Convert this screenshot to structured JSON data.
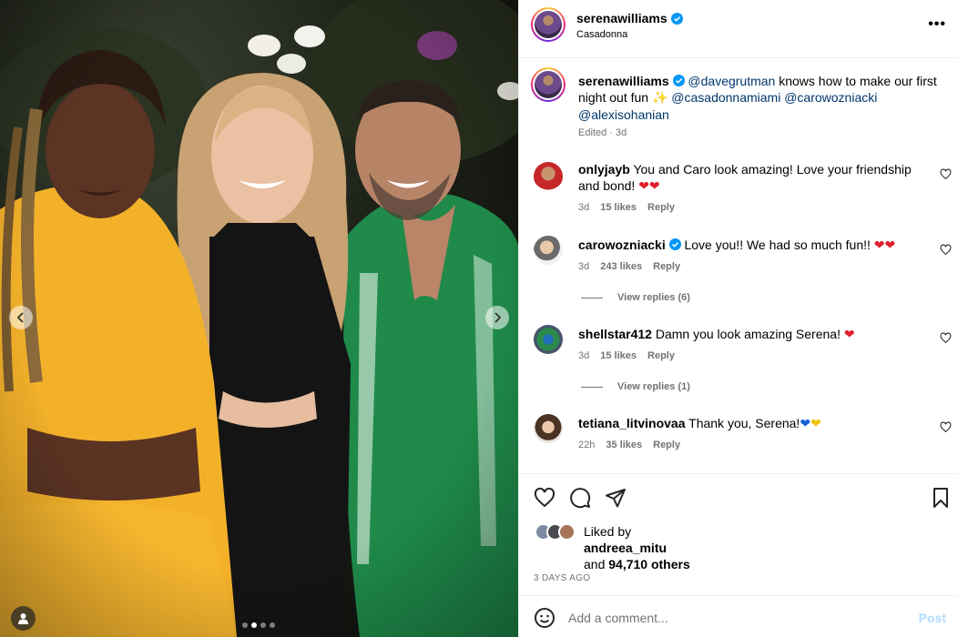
{
  "post": {
    "username": "serenawilliams",
    "location": "Casadonna",
    "more_label": "•••",
    "caption": {
      "username": "serenawilliams",
      "mention_1": "@davegrutman",
      "text_1": " knows how to make our first night out fun ",
      "sparkle_emoji": "✨",
      "mention_2": "@casadonnamiami",
      "mention_3": "@carowozniacki",
      "mention_4": "@alexisohanian",
      "meta": "Edited · 3d"
    }
  },
  "comments": [
    {
      "username": "onlyjayb",
      "text": "You and Caro look amazing! Love your friendship and bond!",
      "emoji": "❤❤",
      "time": "3d",
      "likes": "15 likes",
      "reply": "Reply"
    },
    {
      "username": "carowozniacki",
      "text": "Love you!! We had so much fun!!",
      "emoji": "❤❤",
      "time": "3d",
      "likes": "243 likes",
      "reply": "Reply",
      "view_replies": "View replies (6)"
    },
    {
      "username": "shellstar412",
      "text": "Damn you look amazing Serena!",
      "emoji": "❤",
      "time": "3d",
      "likes": "15 likes",
      "reply": "Reply",
      "view_replies": "View replies (1)"
    },
    {
      "username": "tetiana_litvinovaa",
      "text": "Thank you, Serena!",
      "emoji_blue": "❤",
      "emoji_yellow": "❤",
      "time": "22h",
      "likes": "35 likes",
      "reply": "Reply"
    }
  ],
  "likes": {
    "liked_by_label": "Liked by",
    "liked_by_user": "andreea_mitu",
    "and_label": "and ",
    "others": "94,710 others"
  },
  "time_ago": "3 DAYS AGO",
  "add_comment": {
    "placeholder": "Add a comment...",
    "post_label": "Post"
  },
  "media": {
    "slides": 4,
    "active_slide": 2
  },
  "icons": {
    "verified": "verified-badge-icon",
    "like": "heart-icon",
    "comment": "comment-bubble-icon",
    "share": "paper-plane-icon",
    "save": "bookmark-icon",
    "emoji": "smiley-icon"
  },
  "colors": {
    "verified": "#0095f6",
    "link": "#00376b",
    "secondary": "#737373",
    "post_disabled": "#b3dbff"
  }
}
